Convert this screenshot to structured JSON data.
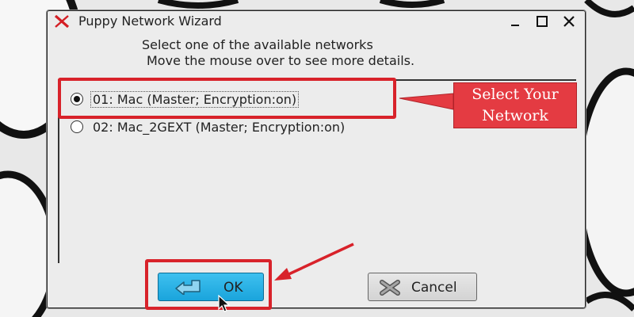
{
  "window": {
    "title": "Puppy Network Wizard",
    "controls": {
      "minimize": "—",
      "maximize": "☐",
      "close": "✕"
    }
  },
  "instructions": {
    "line1": "Select one of the available networks",
    "line2": "Move the mouse over to see more details."
  },
  "networks": [
    {
      "label": "01: Mac (Master; Encryption:on)",
      "selected": true
    },
    {
      "label": "02: Mac_2GEXT (Master; Encryption:on)",
      "selected": false
    }
  ],
  "buttons": {
    "ok": "OK",
    "cancel": "Cancel"
  },
  "annotation": {
    "callout": "Select Your Network",
    "color": "#e43b42"
  },
  "icons": {
    "app": "x-logo-icon",
    "ok": "back-arrow-icon",
    "cancel": "x-cancel-icon",
    "cursor": "mouse-pointer-icon"
  }
}
